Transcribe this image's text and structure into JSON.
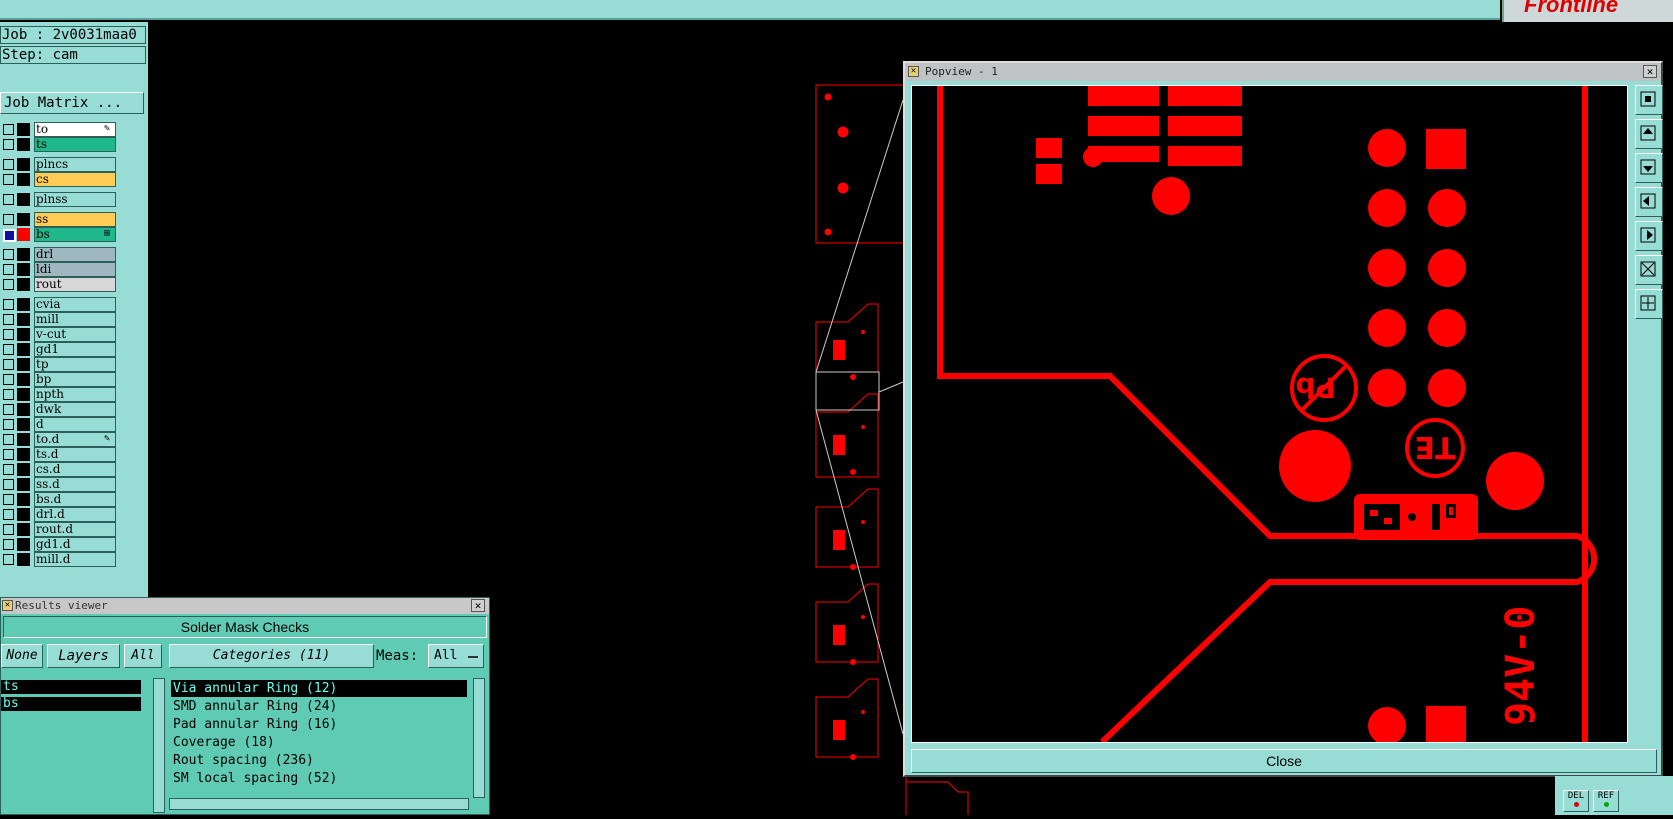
{
  "topbar": {
    "brand": "Frontline"
  },
  "job_info": {
    "job": "Job : 2v0031maa0",
    "step": "Step: cam",
    "job_matrix": "Job Matrix ..."
  },
  "layers": [
    {
      "name": "to",
      "color": "#ffffff",
      "checked": false,
      "swatch": "#000000",
      "mark": "✎"
    },
    {
      "name": "ts",
      "color": "#1fb88a",
      "checked": false,
      "swatch": "#000000",
      "mark": ""
    },
    {
      "name": "plncs",
      "color": "#98dcd6",
      "checked": false,
      "swatch": "#000000",
      "mark": ""
    },
    {
      "name": "cs",
      "color": "#ffcc55",
      "checked": false,
      "swatch": "#000000",
      "mark": ""
    },
    {
      "name": "plnss",
      "color": "#98dcd6",
      "checked": false,
      "swatch": "#000000",
      "mark": ""
    },
    {
      "name": "ss",
      "color": "#ffcc55",
      "checked": false,
      "swatch": "#000000",
      "mark": ""
    },
    {
      "name": "bs",
      "color": "#1fb88a",
      "checked": true,
      "swatch": "#ff0000",
      "mark": "⊞"
    },
    {
      "name": "drl",
      "color": "#9fb8c0",
      "checked": false,
      "swatch": "#000000",
      "mark": ""
    },
    {
      "name": "ldi",
      "color": "#9fb8c0",
      "checked": false,
      "swatch": "#000000",
      "mark": ""
    },
    {
      "name": "rout",
      "color": "#d8d8d8",
      "checked": false,
      "swatch": "#000000",
      "mark": ""
    },
    {
      "name": "cvia",
      "color": "#98dcd6",
      "checked": false,
      "swatch": "#000000",
      "mark": ""
    },
    {
      "name": "mill",
      "color": "#98dcd6",
      "checked": false,
      "swatch": "#000000",
      "mark": ""
    },
    {
      "name": "v-cut",
      "color": "#98dcd6",
      "checked": false,
      "swatch": "#000000",
      "mark": ""
    },
    {
      "name": "gd1",
      "color": "#98dcd6",
      "checked": false,
      "swatch": "#000000",
      "mark": ""
    },
    {
      "name": "tp",
      "color": "#98dcd6",
      "checked": false,
      "swatch": "#000000",
      "mark": ""
    },
    {
      "name": "bp",
      "color": "#98dcd6",
      "checked": false,
      "swatch": "#000000",
      "mark": ""
    },
    {
      "name": "npth",
      "color": "#98dcd6",
      "checked": false,
      "swatch": "#000000",
      "mark": ""
    },
    {
      "name": "dwk",
      "color": "#98dcd6",
      "checked": false,
      "swatch": "#000000",
      "mark": ""
    },
    {
      "name": "d",
      "color": "#98dcd6",
      "checked": false,
      "swatch": "#000000",
      "mark": ""
    },
    {
      "name": "to.d",
      "color": "#98dcd6",
      "checked": false,
      "swatch": "#000000",
      "mark": "✎"
    },
    {
      "name": "ts.d",
      "color": "#98dcd6",
      "checked": false,
      "swatch": "#000000",
      "mark": ""
    },
    {
      "name": "cs.d",
      "color": "#98dcd6",
      "checked": false,
      "swatch": "#000000",
      "mark": ""
    },
    {
      "name": "ss.d",
      "color": "#98dcd6",
      "checked": false,
      "swatch": "#000000",
      "mark": ""
    },
    {
      "name": "bs.d",
      "color": "#98dcd6",
      "checked": false,
      "swatch": "#000000",
      "mark": ""
    },
    {
      "name": "drl.d",
      "color": "#98dcd6",
      "checked": false,
      "swatch": "#000000",
      "mark": ""
    },
    {
      "name": "rout.d",
      "color": "#98dcd6",
      "checked": false,
      "swatch": "#000000",
      "mark": ""
    },
    {
      "name": "gd1.d",
      "color": "#98dcd6",
      "checked": false,
      "swatch": "#000000",
      "mark": ""
    },
    {
      "name": "mill.d",
      "color": "#98dcd6",
      "checked": false,
      "swatch": "#000000",
      "mark": ""
    }
  ],
  "results_viewer": {
    "title": "Results viewer",
    "heading": "Solder Mask Checks",
    "none_label": "None",
    "layers_label": "Layers",
    "all_label": "All",
    "categories_label": "Categories (11)",
    "meas_label": "Meas:",
    "meas_value": "All",
    "result_layers": [
      "ts",
      "bs"
    ],
    "categories": [
      "Via annular Ring (12)",
      "SMD annular Ring (24)",
      "Pad annular Ring (16)",
      "Coverage (18)",
      "Rout spacing (236)",
      "SM local spacing (52)"
    ]
  },
  "popview": {
    "title": "Popview - 1",
    "close_label": "Close",
    "silkscreen_text": "94V-0",
    "logo_text": "TE",
    "tools": [
      "zoom-fit-icon",
      "pan-up-icon",
      "pan-down-icon",
      "pan-left-icon",
      "pan-right-icon",
      "zoom-in-icon",
      "zoom-out-icon"
    ]
  },
  "status": {
    "del_label": "DEL",
    "ref_label": "REF"
  },
  "colors": {
    "board": "#ff0000",
    "panel": "#98dcd6",
    "results_bg": "#5fcbb4"
  }
}
